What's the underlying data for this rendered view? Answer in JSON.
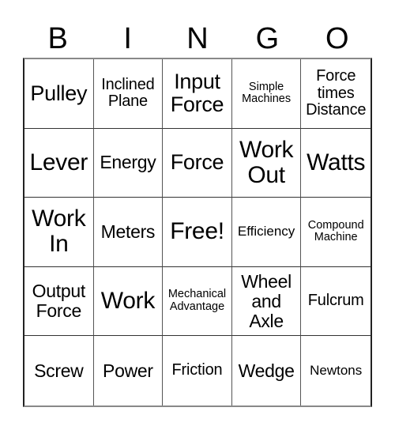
{
  "header": {
    "letters": [
      "B",
      "I",
      "N",
      "G",
      "O"
    ]
  },
  "card": {
    "cells": [
      [
        "Pulley",
        "Inclined\nPlane",
        "Input\nForce",
        "Simple\nMachines",
        "Force\ntimes\nDistance"
      ],
      [
        "Lever",
        "Energy",
        "Force",
        "Work\nOut",
        "Watts"
      ],
      [
        "Work\nIn",
        "Meters",
        "Free!",
        "Efficiency",
        "Compound\nMachine"
      ],
      [
        "Output\nForce",
        "Work",
        "Mechanical\nAdvantage",
        "Wheel\nand\nAxle",
        "Fulcrum"
      ],
      [
        "Screw",
        "Power",
        "Friction",
        "Wedge",
        "Newtons"
      ]
    ],
    "free_space": "Free!"
  }
}
